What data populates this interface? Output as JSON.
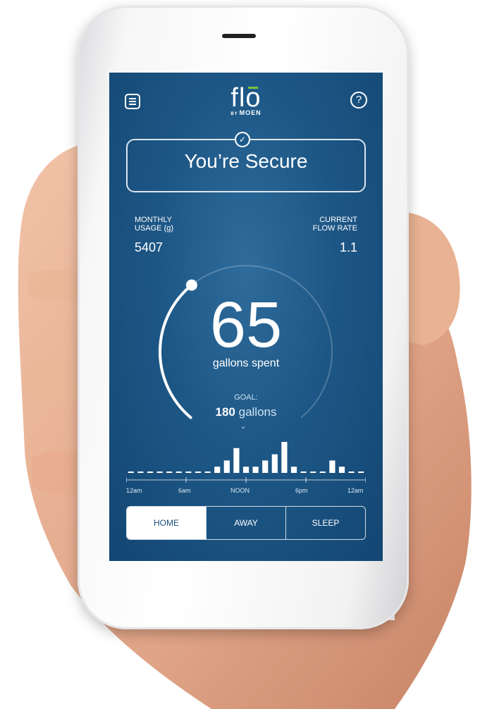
{
  "header": {
    "logo_main": "flo",
    "logo_by": "BY",
    "logo_brand": "MOEN",
    "help_symbol": "?"
  },
  "status": {
    "text": "You’re Secure",
    "check_symbol": "✓"
  },
  "stats": {
    "monthly_label_1": "MONTHLY",
    "monthly_label_2": "USAGE (g)",
    "monthly_value": "5407",
    "flow_label_1": "CURRENT",
    "flow_label_2": "FLOW RATE",
    "flow_value": "1.1"
  },
  "gauge": {
    "value": "65",
    "unit_label": "gallons spent",
    "progress": 0.36
  },
  "goal": {
    "label": "GOAL:",
    "amount": "180",
    "unit": "gallons",
    "chevron": "⌄"
  },
  "chart_data": {
    "type": "bar",
    "x_labels": [
      "12am",
      "6am",
      "NOON",
      "6pm",
      "12am"
    ],
    "values": [
      0,
      0,
      0,
      0,
      0,
      0,
      0,
      0,
      0,
      1,
      2,
      4,
      1,
      1,
      2,
      3,
      5,
      1,
      0,
      0,
      0,
      2,
      1,
      0,
      0
    ]
  },
  "modes": [
    {
      "label": "HOME",
      "active": true
    },
    {
      "label": "AWAY",
      "active": false
    },
    {
      "label": "SLEEP",
      "active": false
    }
  ],
  "colors": {
    "screen_bg": "#1d5786",
    "accent_green": "#7dc242",
    "active_text": "#1a4e7a"
  },
  "icons": {
    "menu": "menu-icon",
    "help": "help-icon",
    "check": "check-icon"
  }
}
